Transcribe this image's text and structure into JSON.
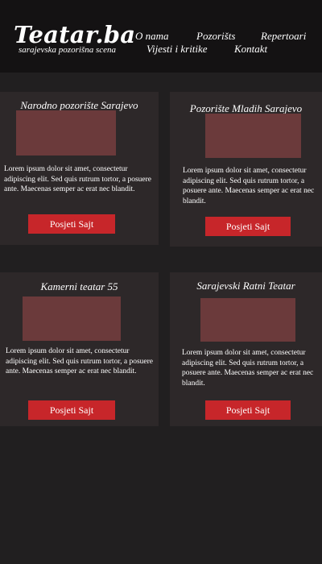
{
  "header": {
    "logo_title": "Teatar.ba",
    "logo_tagline": "sarajevska pozorišna scena",
    "nav": {
      "o_nama": "O nama",
      "pozorista": "Pozorišts",
      "repertoari": "Repertoari",
      "vijesti": "Vijesti i kritike",
      "kontakt": "Kontakt"
    }
  },
  "cards": [
    {
      "title": "Narodno pozorište Sarajevo",
      "text": "Lorem ipsum dolor sit amet, consectetur adipiscing elit. Sed quis rutrum tortor, a posuere ante. Maecenas semper ac erat nec blandit.",
      "button": "Posjeti Sajt"
    },
    {
      "title": "Pozorište Mladih Sarajevo",
      "text": "Lorem ipsum dolor sit amet, consectetur adipiscing elit. Sed quis rutrum tortor, a posuere ante. Maecenas semper ac erat nec blandit.",
      "button": "Posjeti Sajt"
    },
    {
      "title": "Kamerni teatar 55",
      "text": "Lorem ipsum dolor sit amet, consectetur adipiscing elit. Sed quis rutrum tortor, a posuere ante. Maecenas semper ac erat nec blandit.",
      "button": "Posjeti Sajt"
    },
    {
      "title": "Sarajevski Ratni Teatar",
      "text": "Lorem ipsum dolor sit amet, consectetur adipiscing elit. Sed quis rutrum tortor, a posuere ante. Maecenas semper ac erat nec blandit.",
      "button": "Posjeti Sajt"
    }
  ],
  "colors": {
    "page_background": "#211f20",
    "header_background": "#141213",
    "card_background": "#2d2829",
    "image_placeholder": "#6b3a3b",
    "button": "#c7262a"
  }
}
